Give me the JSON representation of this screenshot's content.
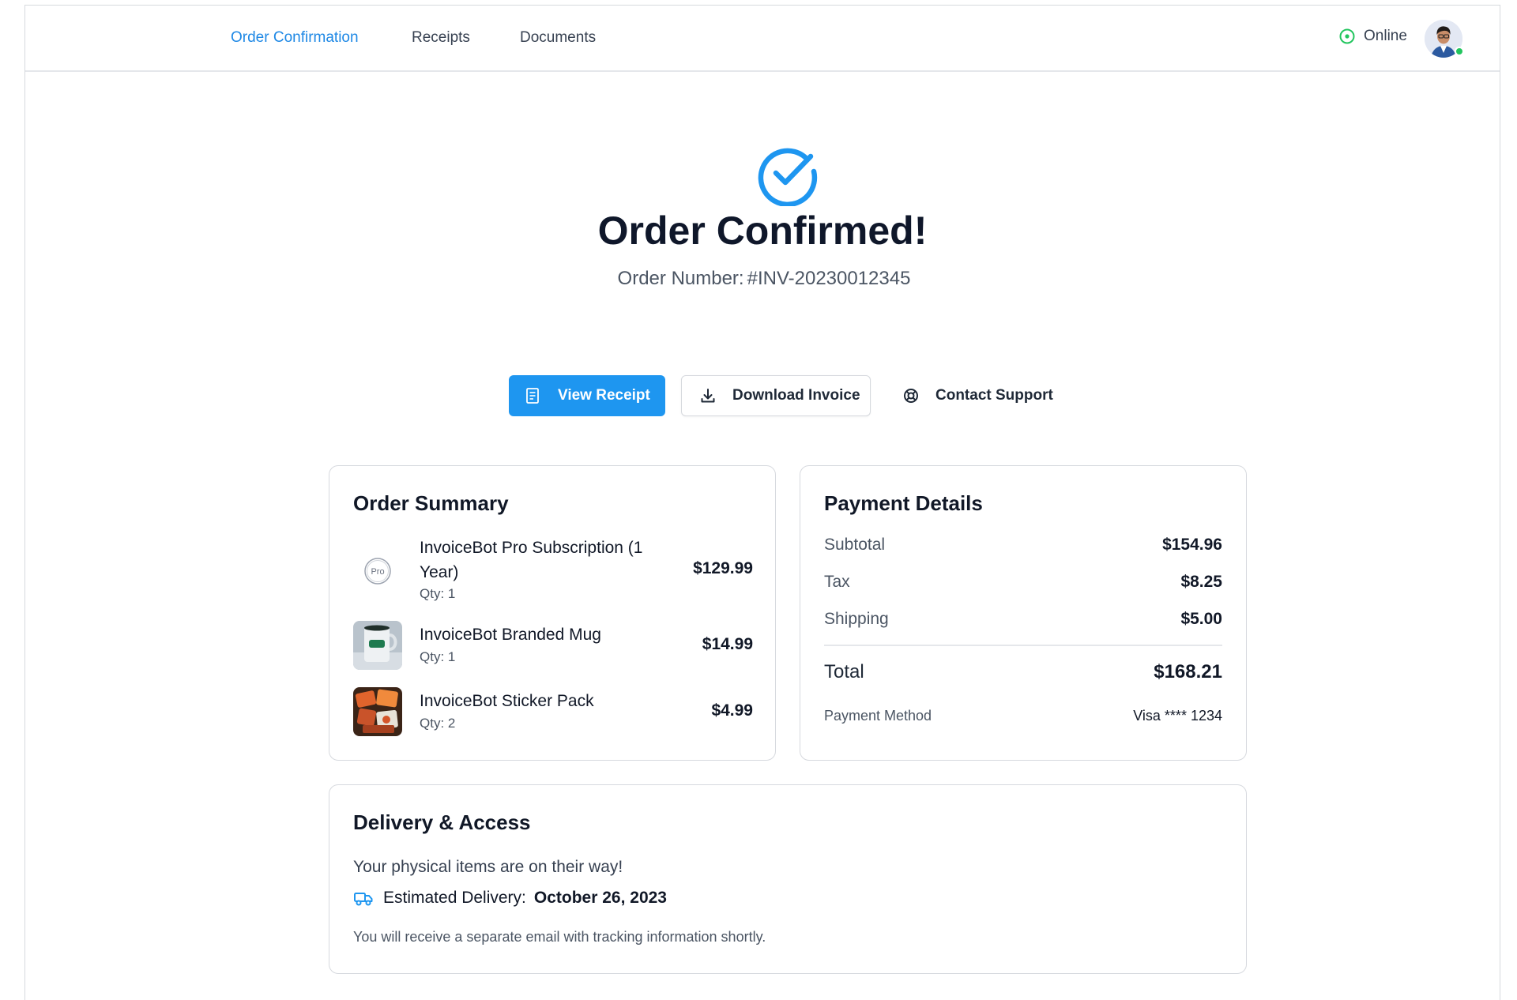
{
  "nav": {
    "links": [
      "Order Confirmation",
      "Receipts",
      "Documents"
    ],
    "active_index": 0,
    "status_label": "Online"
  },
  "hero": {
    "title": "Order Confirmed!",
    "order_number_label": "Order Number:",
    "order_number": "#INV-20230012345"
  },
  "actions": {
    "view_receipt": "View Receipt",
    "download_invoice": "Download Invoice",
    "contact_support": "Contact Support"
  },
  "order_summary": {
    "title": "Order Summary",
    "items": [
      {
        "name": "InvoiceBot Pro Subscription (1 Year)",
        "qty": "Qty: 1",
        "price": "$129.99",
        "thumb": "pro-badge-icon",
        "badge_text": "Pro"
      },
      {
        "name": "InvoiceBot Branded Mug",
        "qty": "Qty: 1",
        "price": "$14.99",
        "thumb": "mug-image"
      },
      {
        "name": "InvoiceBot Sticker Pack",
        "qty": "Qty: 2",
        "price": "$4.99",
        "thumb": "sticker-pack-image"
      }
    ]
  },
  "payment": {
    "title": "Payment Details",
    "rows": [
      {
        "label": "Subtotal",
        "value": "$154.96"
      },
      {
        "label": "Tax",
        "value": "$8.25"
      },
      {
        "label": "Shipping",
        "value": "$5.00"
      }
    ],
    "total_label": "Total",
    "total_value": "$168.21",
    "method_label": "Payment Method",
    "method_value": "Visa **** 1234"
  },
  "delivery": {
    "title": "Delivery & Access",
    "message": "Your physical items are on their way!",
    "estimate_label": "Estimated Delivery:",
    "estimate_value": "October 26, 2023",
    "note": "You will receive a separate email with tracking information shortly."
  },
  "colors": {
    "accent": "#1e96f0",
    "online": "#22c55e",
    "border": "#d6d9de"
  }
}
